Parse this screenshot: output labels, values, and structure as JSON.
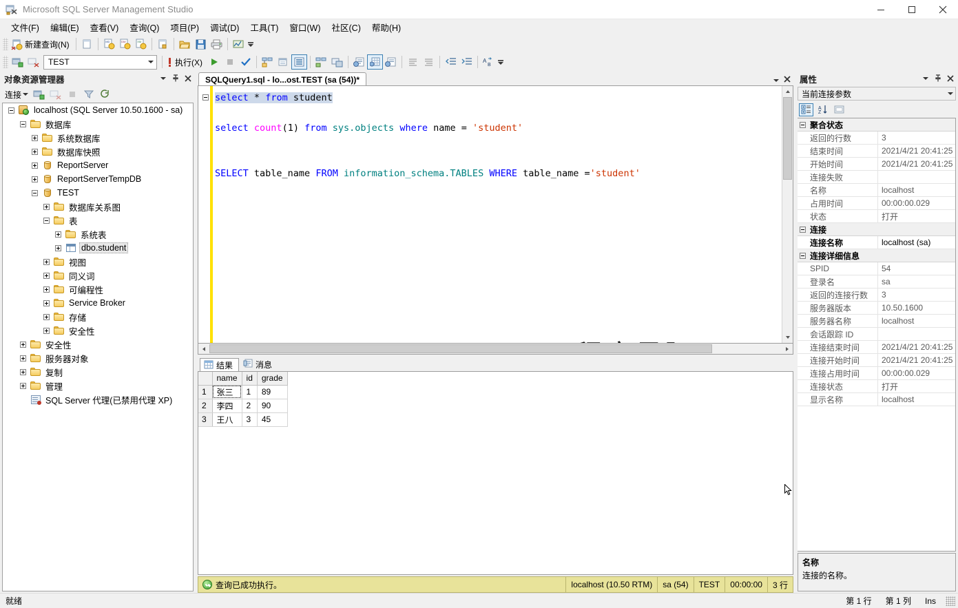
{
  "window": {
    "title": "Microsoft SQL Server Management Studio",
    "app_icon": "ssms-icon",
    "minimize": "minimize-icon",
    "maximize": "maximize-icon",
    "close": "close-icon"
  },
  "menubar": {
    "items": [
      {
        "label": "文件(F)",
        "name": "menu-file"
      },
      {
        "label": "编辑(E)",
        "name": "menu-edit"
      },
      {
        "label": "查看(V)",
        "name": "menu-view"
      },
      {
        "label": "查询(Q)",
        "name": "menu-query"
      },
      {
        "label": "项目(P)",
        "name": "menu-project"
      },
      {
        "label": "调试(D)",
        "name": "menu-debug"
      },
      {
        "label": "工具(T)",
        "name": "menu-tools"
      },
      {
        "label": "窗口(W)",
        "name": "menu-window"
      },
      {
        "label": "社区(C)",
        "name": "menu-community"
      },
      {
        "label": "帮助(H)",
        "name": "menu-help"
      }
    ]
  },
  "toolbar_main": {
    "new_query_label": "新建查询(N)",
    "icons": [
      "new-query-icon",
      "new-file-icon",
      "new-mdx-query-icon",
      "new-dmx-query-icon",
      "new-xmla-query-icon",
      "new-project-item-icon",
      "open-file-icon",
      "save-icon",
      "print-icon",
      "analysis-icon"
    ]
  },
  "toolbar_query": {
    "database_value": "TEST",
    "execute_label": "执行(X)",
    "icons": [
      "connect-icon",
      "disconnect-icon",
      "debug-icon",
      "execute-play-icon",
      "stop-icon",
      "parse-check-icon",
      "display-estimated-plan-icon",
      "query-options-icon",
      "include-actual-plan-icon",
      "include-client-statistics-icon",
      "results-to-text-icon",
      "results-to-grid-icon",
      "results-to-file-icon",
      "comment-icon",
      "uncomment-icon",
      "decrease-indent-icon",
      "increase-indent-icon",
      "find-replace-icon"
    ]
  },
  "object_explorer": {
    "title": "对象资源管理器",
    "window_dropdown_icon": "chevron-down-icon",
    "pin_icon": "pin-icon",
    "close_icon": "close-icon",
    "connect_label": "连接",
    "toolbar_icons": [
      "connect-icon",
      "disconnect-icon",
      "stop-icon",
      "filter-icon",
      "refresh-icon"
    ],
    "tree": [
      {
        "label": "localhost (SQL Server 10.50.1600 - sa)",
        "indent": 0,
        "expander": "minus",
        "icon": "server-icon",
        "selected": false
      },
      {
        "label": "数据库",
        "indent": 1,
        "expander": "minus",
        "icon": "folder-icon",
        "selected": false
      },
      {
        "label": "系统数据库",
        "indent": 2,
        "expander": "plus",
        "icon": "folder-icon",
        "selected": false
      },
      {
        "label": "数据库快照",
        "indent": 2,
        "expander": "plus",
        "icon": "folder-icon",
        "selected": false
      },
      {
        "label": "ReportServer",
        "indent": 2,
        "expander": "plus",
        "icon": "database-icon",
        "selected": false
      },
      {
        "label": "ReportServerTempDB",
        "indent": 2,
        "expander": "plus",
        "icon": "database-icon",
        "selected": false
      },
      {
        "label": "TEST",
        "indent": 2,
        "expander": "minus",
        "icon": "database-icon",
        "selected": false
      },
      {
        "label": "数据库关系图",
        "indent": 3,
        "expander": "plus",
        "icon": "folder-icon",
        "selected": false
      },
      {
        "label": "表",
        "indent": 3,
        "expander": "minus",
        "icon": "folder-icon",
        "selected": false
      },
      {
        "label": "系统表",
        "indent": 4,
        "expander": "plus",
        "icon": "folder-icon",
        "selected": false
      },
      {
        "label": "dbo.student",
        "indent": 4,
        "expander": "plus",
        "icon": "table-icon",
        "selected": true
      },
      {
        "label": "视图",
        "indent": 3,
        "expander": "plus",
        "icon": "folder-icon",
        "selected": false
      },
      {
        "label": "同义词",
        "indent": 3,
        "expander": "plus",
        "icon": "folder-icon",
        "selected": false
      },
      {
        "label": "可编程性",
        "indent": 3,
        "expander": "plus",
        "icon": "folder-icon",
        "selected": false
      },
      {
        "label": "Service Broker",
        "indent": 3,
        "expander": "plus",
        "icon": "folder-icon",
        "selected": false
      },
      {
        "label": "存储",
        "indent": 3,
        "expander": "plus",
        "icon": "folder-icon",
        "selected": false
      },
      {
        "label": "安全性",
        "indent": 3,
        "expander": "plus",
        "icon": "folder-icon",
        "selected": false
      },
      {
        "label": "安全性",
        "indent": 1,
        "expander": "plus",
        "icon": "folder-icon",
        "selected": false
      },
      {
        "label": "服务器对象",
        "indent": 1,
        "expander": "plus",
        "icon": "folder-icon",
        "selected": false
      },
      {
        "label": "复制",
        "indent": 1,
        "expander": "plus",
        "icon": "folder-icon",
        "selected": false
      },
      {
        "label": "管理",
        "indent": 1,
        "expander": "plus",
        "icon": "folder-icon",
        "selected": false
      },
      {
        "label": "SQL Server 代理(已禁用代理 XP)",
        "indent": 1,
        "expander": "none",
        "icon": "agent-icon",
        "selected": false
      }
    ]
  },
  "editor": {
    "tab_title": "SQLQuery1.sql - lo...ost.TEST (sa (54))*",
    "tab_dropdown_icon": "chevron-down-icon",
    "tab_close_icon": "close-icon",
    "watermark": "程序员阿飞",
    "lines": [
      {
        "selected": true,
        "collapse": true,
        "tokens": [
          {
            "t": "select",
            "c": "k"
          },
          {
            "t": " ",
            "c": "id"
          },
          {
            "t": "*",
            "c": "id"
          },
          {
            "t": " ",
            "c": "id"
          },
          {
            "t": "from",
            "c": "k"
          },
          {
            "t": " student",
            "c": "id"
          }
        ]
      },
      {
        "selected": false,
        "collapse": false,
        "tokens": []
      },
      {
        "selected": false,
        "collapse": false,
        "tokens": [
          {
            "t": "select",
            "c": "k"
          },
          {
            "t": " ",
            "c": "id"
          },
          {
            "t": "count",
            "c": "fn"
          },
          {
            "t": "(1)",
            "c": "id"
          },
          {
            "t": " ",
            "c": "id"
          },
          {
            "t": "from",
            "c": "k"
          },
          {
            "t": " ",
            "c": "id"
          },
          {
            "t": "sys",
            "c": "tealid"
          },
          {
            "t": ".objects",
            "c": "tealid"
          },
          {
            "t": " ",
            "c": "id"
          },
          {
            "t": "where",
            "c": "k"
          },
          {
            "t": " name ",
            "c": "id"
          },
          {
            "t": "=",
            "c": "id"
          },
          {
            "t": " ",
            "c": "id"
          },
          {
            "t": "'student'",
            "c": "s"
          }
        ]
      },
      {
        "selected": false,
        "collapse": false,
        "tokens": []
      },
      {
        "selected": false,
        "collapse": false,
        "tokens": []
      },
      {
        "selected": false,
        "collapse": false,
        "tokens": [
          {
            "t": "SELECT",
            "c": "k"
          },
          {
            "t": " table_name ",
            "c": "id"
          },
          {
            "t": "FROM",
            "c": "k"
          },
          {
            "t": " ",
            "c": "id"
          },
          {
            "t": "information_schema",
            "c": "tealid"
          },
          {
            "t": ".TABLES",
            "c": "tealid"
          },
          {
            "t": " ",
            "c": "id"
          },
          {
            "t": "WHERE",
            "c": "k"
          },
          {
            "t": " table_name ",
            "c": "id"
          },
          {
            "t": "=",
            "c": "id"
          },
          {
            "t": "'student'",
            "c": "s"
          }
        ]
      }
    ]
  },
  "results": {
    "tabs": [
      {
        "label": "结果",
        "icon": "grid-icon",
        "active": true
      },
      {
        "label": "消息",
        "icon": "message-icon",
        "active": false
      }
    ],
    "columns": [
      "name",
      "id",
      "grade"
    ],
    "rows": [
      {
        "n": "1",
        "name": "张三",
        "id": "1",
        "grade": "89"
      },
      {
        "n": "2",
        "name": "李四",
        "id": "2",
        "grade": "90"
      },
      {
        "n": "3",
        "name": "王八",
        "id": "3",
        "grade": "45"
      }
    ]
  },
  "query_status": {
    "icon": "success-check-icon",
    "message": "查询已成功执行。",
    "server": "localhost (10.50 RTM)",
    "login": "sa (54)",
    "database": "TEST",
    "elapsed": "00:00:00",
    "rowcount": "3 行"
  },
  "properties": {
    "title": "属性",
    "window_dropdown_icon": "chevron-down-icon",
    "pin_icon": "pin-icon",
    "close_icon": "close-icon",
    "selected_object": "当前连接参数",
    "toolbar_icons": [
      "categorized-icon",
      "alphabetical-icon",
      "property-pages-icon"
    ],
    "rows": [
      {
        "type": "group",
        "label": "聚合状态"
      },
      {
        "type": "prop",
        "name": "返回的行数",
        "value": "3"
      },
      {
        "type": "prop",
        "name": "结束时间",
        "value": "2021/4/21 20:41:25"
      },
      {
        "type": "prop",
        "name": "开始时间",
        "value": "2021/4/21 20:41:25"
      },
      {
        "type": "prop",
        "name": "连接失败",
        "value": ""
      },
      {
        "type": "prop",
        "name": "名称",
        "value": "localhost"
      },
      {
        "type": "prop",
        "name": "占用时间",
        "value": "00:00:00.029"
      },
      {
        "type": "prop",
        "name": "状态",
        "value": "打开"
      },
      {
        "type": "group",
        "label": "连接"
      },
      {
        "type": "prop",
        "name": "连接名称",
        "value": "localhost (sa)",
        "selected": true
      },
      {
        "type": "group",
        "label": "连接详细信息"
      },
      {
        "type": "prop",
        "name": "SPID",
        "value": "54"
      },
      {
        "type": "prop",
        "name": "登录名",
        "value": "sa"
      },
      {
        "type": "prop",
        "name": "返回的连接行数",
        "value": "3"
      },
      {
        "type": "prop",
        "name": "服务器版本",
        "value": "10.50.1600"
      },
      {
        "type": "prop",
        "name": "服务器名称",
        "value": "localhost"
      },
      {
        "type": "prop",
        "name": "会话跟踪 ID",
        "value": ""
      },
      {
        "type": "prop",
        "name": "连接结束时间",
        "value": "2021/4/21 20:41:25"
      },
      {
        "type": "prop",
        "name": "连接开始时间",
        "value": "2021/4/21 20:41:25"
      },
      {
        "type": "prop",
        "name": "连接占用时间",
        "value": "00:00:00.029"
      },
      {
        "type": "prop",
        "name": "连接状态",
        "value": "打开"
      },
      {
        "type": "prop",
        "name": "显示名称",
        "value": "localhost"
      }
    ],
    "description_title": "名称",
    "description_text": "连接的名称。"
  },
  "statusbar": {
    "ready": "就绪",
    "line": "第 1 行",
    "column": "第 1 列",
    "insert_mode": "Ins"
  }
}
